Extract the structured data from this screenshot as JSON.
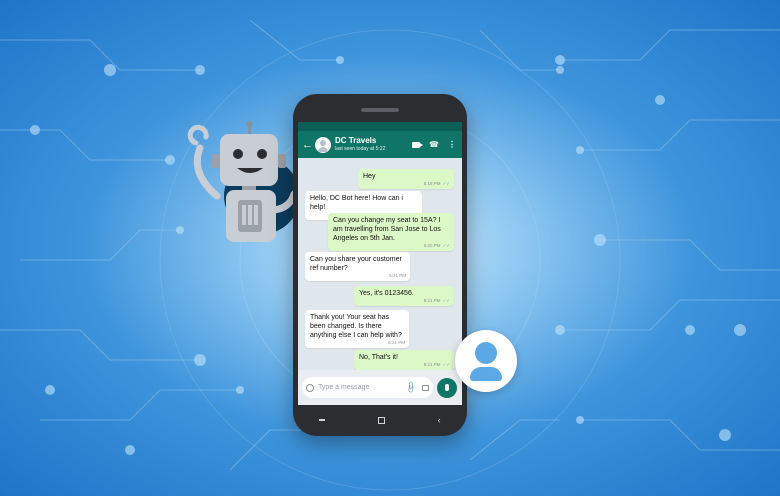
{
  "chat": {
    "contact_name": "DC Travels",
    "last_seen": "last seen today at 5:22",
    "input_placeholder": "Type a message",
    "messages": [
      {
        "dir": "out",
        "text": "Hey",
        "time": "5:18 PM"
      },
      {
        "dir": "in",
        "text": "Hello, DC Bot here! How can i help!",
        "time": "5:20 PM"
      },
      {
        "dir": "out",
        "text": "Can you change my seat to 15A? I am travelling from San Jose to Los Angeles on 5th Jan.",
        "time": "5:20 PM"
      },
      {
        "dir": "in",
        "text": "Can you share your customer ref number?",
        "time": "5:21 PM"
      },
      {
        "dir": "out",
        "text": "Yes, it's  0123456.",
        "time": "5:21 PM"
      },
      {
        "dir": "in",
        "text": "Thank you! Your seat has been changed. Is there anything else I can help with?",
        "time": "5:21 PM"
      },
      {
        "dir": "out",
        "text": "No, That's it!",
        "time": "5:21 PM"
      }
    ]
  },
  "icons": {
    "back": "back-arrow-icon",
    "video": "video-call-icon",
    "call": "phone-call-icon",
    "menu": "more-vertical-icon",
    "emoji": "emoji-icon",
    "attach": "paperclip-icon",
    "camera": "camera-icon",
    "mic": "microphone-icon"
  },
  "colors": {
    "header": "#0f7566",
    "outgoing_bubble": "#dcf8c6",
    "incoming_bubble": "#ffffff",
    "background": "#2f86d6"
  }
}
